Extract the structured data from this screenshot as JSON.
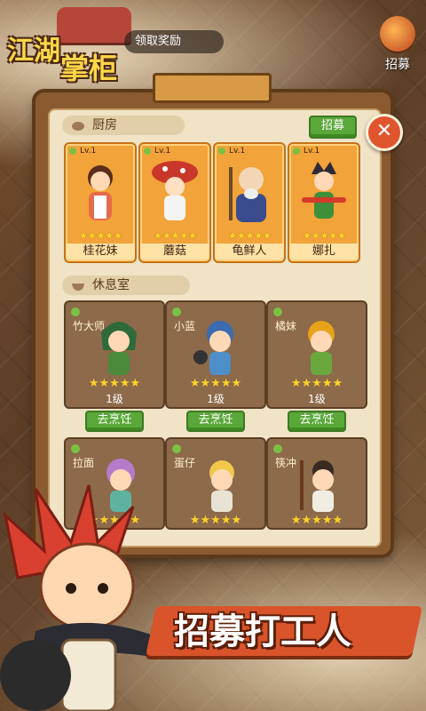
{
  "header": {
    "logo_line1": "江湖",
    "logo_line2": "掌柜",
    "reward_text": "领取奖励",
    "recruit_label": "招募"
  },
  "panel": {
    "close_symbol": "✕",
    "kitchen": {
      "title": "厨房",
      "recruit_button": "招募",
      "staff": [
        {
          "level": "Lv.1",
          "name": "桂花妹",
          "stars": "★★★★★"
        },
        {
          "level": "Lv.1",
          "name": "蘑菇",
          "stars": "★★★★★"
        },
        {
          "level": "Lv.1",
          "name": "龟鲜人",
          "stars": "★★★★★"
        },
        {
          "level": "Lv.1",
          "name": "娜扎",
          "stars": "★★★★★"
        }
      ]
    },
    "restroom": {
      "title": "休息室",
      "staff": [
        {
          "name": "竹大师",
          "stars": "★★★★★",
          "level": "1级",
          "action": "去烹饪"
        },
        {
          "name": "小蓝",
          "stars": "★★★★★",
          "level": "1级",
          "action": "去烹饪"
        },
        {
          "name": "橘妹",
          "stars": "★★★★★",
          "level": "1级",
          "action": "去烹饪"
        },
        {
          "name": "拉面",
          "stars": "★★★★★"
        },
        {
          "name": "蛋仔",
          "stars": "★★★★★"
        },
        {
          "name": "筷冲",
          "stars": "★★★★★"
        }
      ]
    }
  },
  "banner": {
    "text": "招募打工人"
  },
  "colors": {
    "accent": "#5aa83a",
    "banner": "#d9542b",
    "card_gold": "#f2a33a"
  }
}
